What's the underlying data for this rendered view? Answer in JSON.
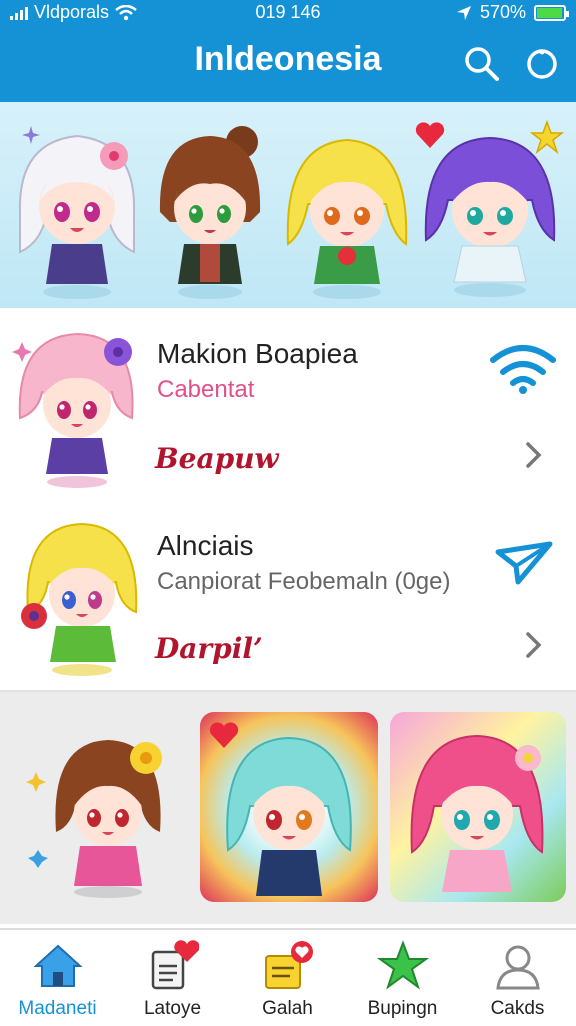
{
  "status": {
    "carrier": "Vldporals",
    "time": "019 146",
    "battery": "570%",
    "battery_level": 0.95
  },
  "header": {
    "title": "Inldeonesia"
  },
  "cards": [
    {
      "name": "Makion Boapiea",
      "subtitle": "Cabentat",
      "tag": "Beapuw",
      "subtitle_color": "#e0508a",
      "action_icon": "wifi-icon"
    },
    {
      "name": "Alnciais",
      "subtitle": "Canpiorat Feobemaln (0ge)",
      "tag": "Darpil’",
      "subtitle_color": "#666666",
      "action_icon": "send-icon"
    }
  ],
  "nav": {
    "items": [
      {
        "label": "Madaneti",
        "icon": "home-icon",
        "active": true
      },
      {
        "label": "Latoye",
        "icon": "document-heart-icon",
        "active": false
      },
      {
        "label": "Galah",
        "icon": "note-badge-icon",
        "active": false
      },
      {
        "label": "Bupingn",
        "icon": "star-icon",
        "active": false
      },
      {
        "label": "Cakds",
        "icon": "profile-icon",
        "active": false
      }
    ]
  },
  "colors": {
    "primary": "#1592d6",
    "active_nav": "#1592d6",
    "tag": "#b0152d"
  }
}
